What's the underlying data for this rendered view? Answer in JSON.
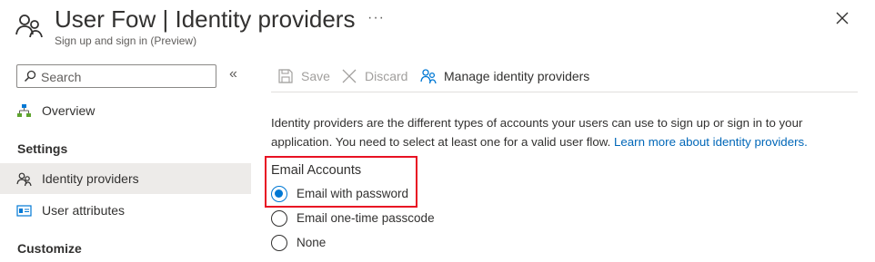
{
  "header": {
    "title_main": "User Fow",
    "title_sep": "|",
    "title_sub": "Identity providers",
    "subtitle": "Sign up and sign in (Preview)",
    "more_label": "···"
  },
  "search": {
    "placeholder": "Search",
    "collapse_label": "«"
  },
  "sidebar": {
    "overview_label": "Overview",
    "settings_heading": "Settings",
    "items": [
      {
        "label": "Identity providers",
        "icon": "users-icon",
        "selected": true
      },
      {
        "label": "User attributes",
        "icon": "id-card-icon",
        "selected": false
      }
    ],
    "customize_heading": "Customize"
  },
  "toolbar": {
    "save_label": "Save",
    "discard_label": "Discard",
    "manage_label": "Manage identity providers"
  },
  "main": {
    "description": "Identity providers are the different types of accounts your users can use to sign up or sign in to your application. You need to select at least one for a valid user flow. ",
    "learn_more": "Learn more about identity providers.",
    "group_label": "Email Accounts",
    "options": [
      {
        "label": "Email with password",
        "checked": true
      },
      {
        "label": "Email one-time passcode",
        "checked": false
      },
      {
        "label": "None",
        "checked": false
      }
    ]
  },
  "colors": {
    "accent": "#0078d4",
    "highlight": "#e81123",
    "link": "#0067b8"
  }
}
